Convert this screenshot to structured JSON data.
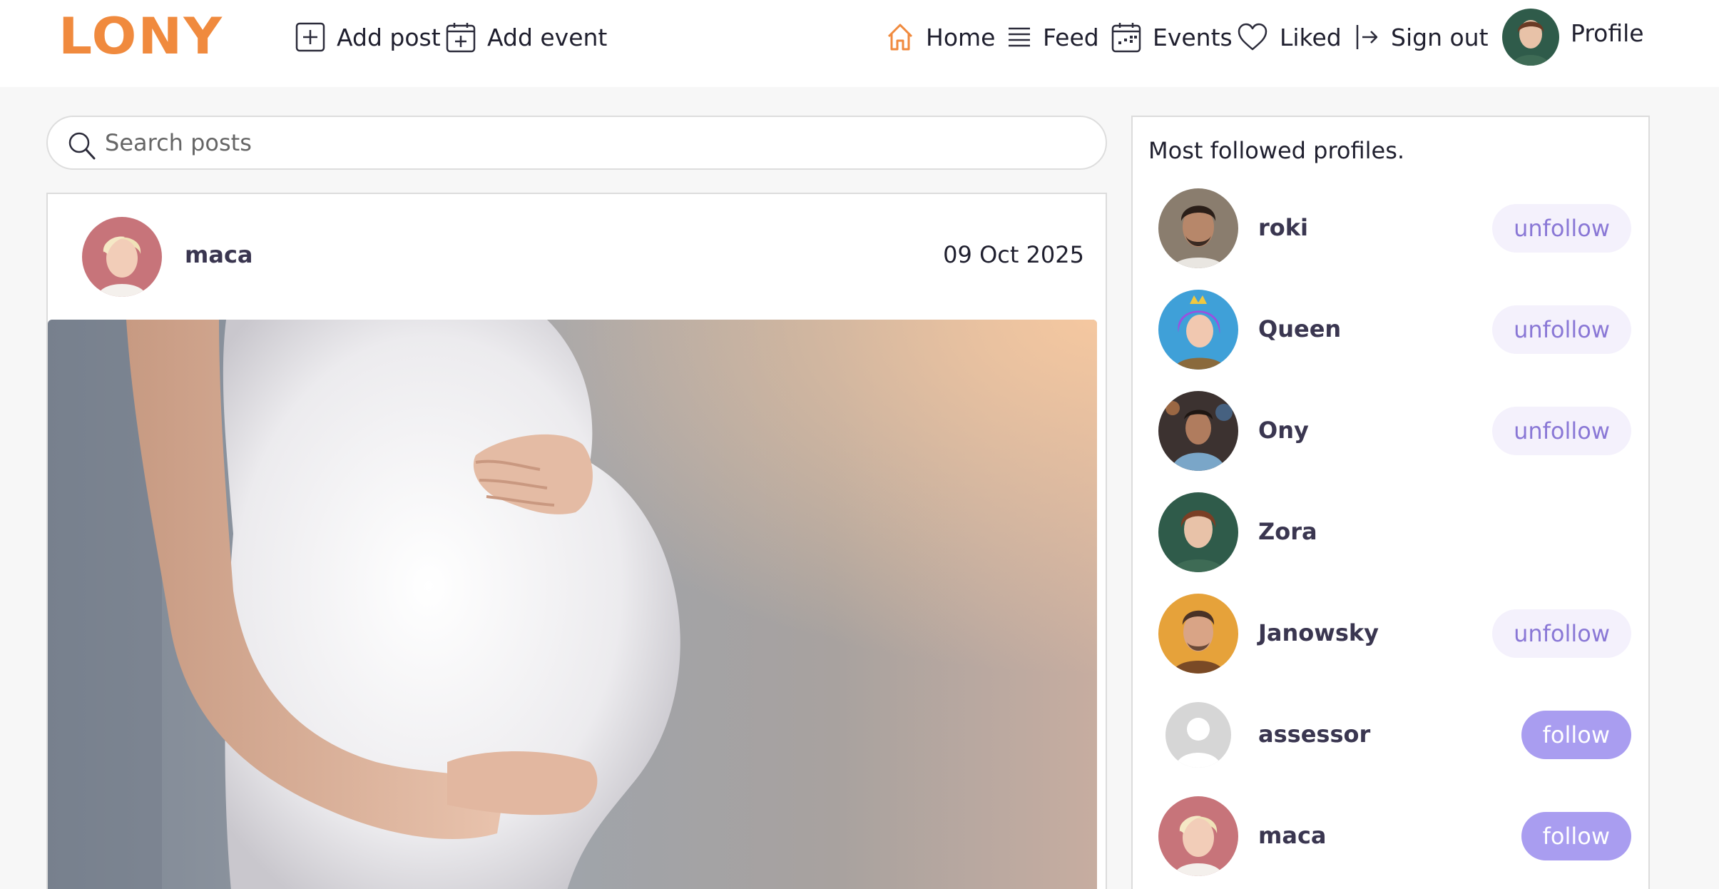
{
  "header": {
    "logo": "LONY",
    "nav": {
      "add_post": "Add post",
      "add_event": "Add event",
      "home": "Home",
      "feed": "Feed",
      "events": "Events",
      "liked": "Liked",
      "sign_out": "Sign out",
      "profile": "Profile"
    }
  },
  "search": {
    "placeholder": "Search posts",
    "value": ""
  },
  "post": {
    "author": "maca",
    "date": "09 Oct 2025",
    "image_icon": "photo-pregnant-woman"
  },
  "sidebar": {
    "title": "Most followed profiles.",
    "profiles": [
      {
        "name": "roki",
        "action": "unfollow"
      },
      {
        "name": "Queen",
        "action": "unfollow"
      },
      {
        "name": "Ony",
        "action": "unfollow"
      },
      {
        "name": "Zora",
        "action": ""
      },
      {
        "name": "Janowsky",
        "action": "unfollow"
      },
      {
        "name": "assessor",
        "action": "follow"
      },
      {
        "name": "maca",
        "action": "follow"
      }
    ]
  },
  "colors": {
    "brand": "#f08a3e",
    "accent": "#8a78d6",
    "follow_bg": "#a99df0",
    "unfollow_bg": "#f4f1fc"
  }
}
